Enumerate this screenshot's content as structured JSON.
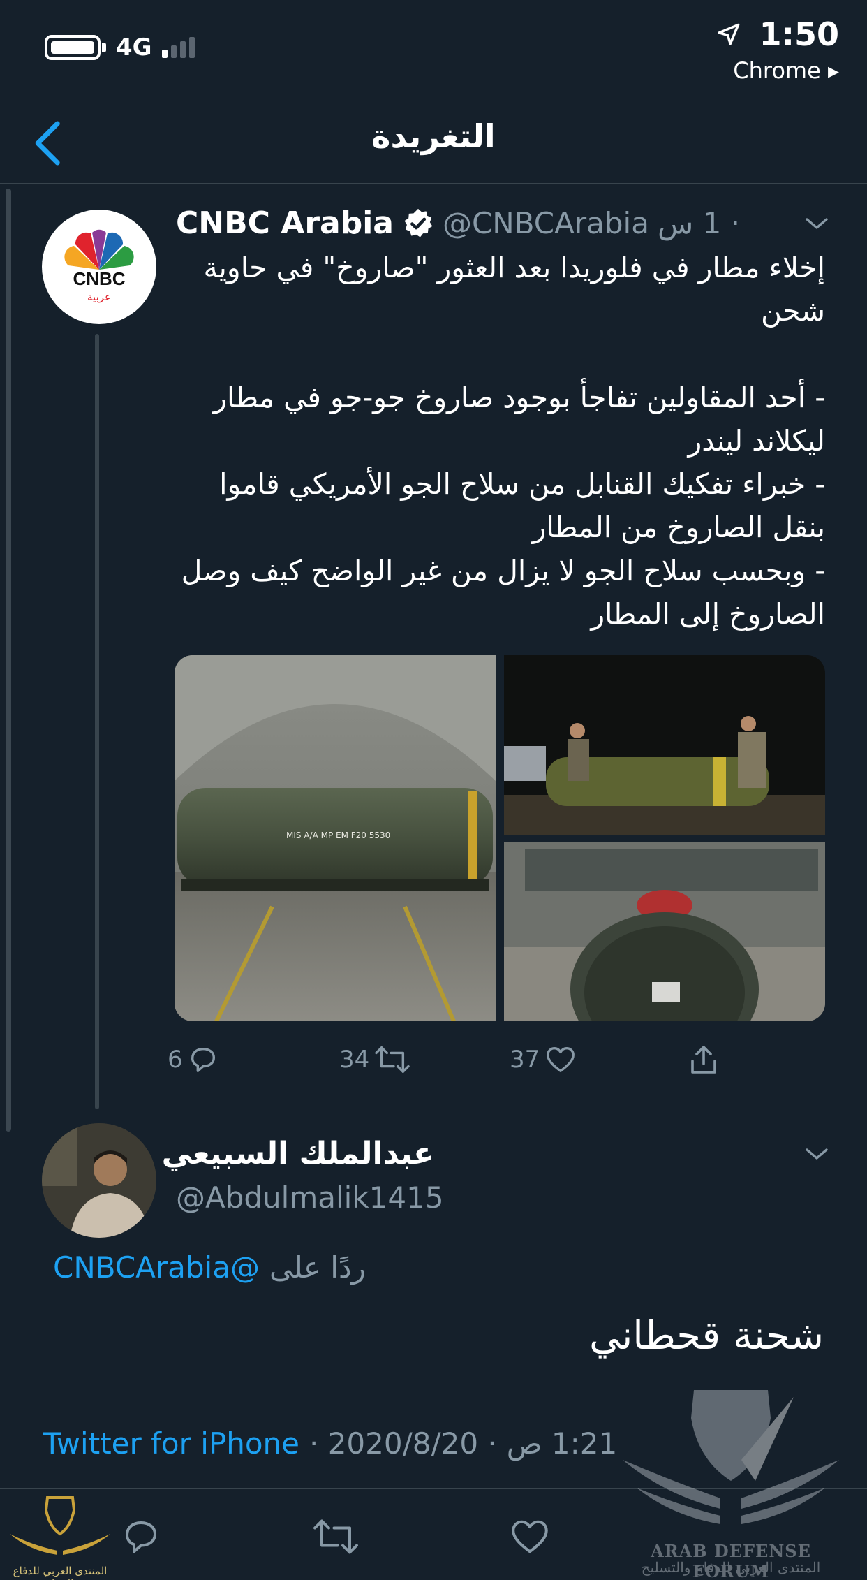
{
  "status_bar": {
    "network": "4G",
    "time": "1:50",
    "back_app": "Chrome ▸"
  },
  "header": {
    "title": "التغريدة"
  },
  "quoted_tweet": {
    "display_name": "CNBC Arabia",
    "handle": "@CNBCArabia",
    "time_ago": "· 1 س",
    "avatar_text": "CNBC",
    "avatar_subtext": "عربية",
    "text": "إخلاء مطار في فلوريدا بعد العثور \"صاروخ\" في حاوية شحن\n\n- أحد المقاولين تفاجأ بوجود صاروخ جو-جو  في مطار ليكلاند ليندر\n- خبراء تفكيك القنابل من سلاح الجو الأمريكي قاموا بنقل الصاروخ  من المطار\n- وبحسب سلاح الجو لا يزال من غير الواضح  كيف وصل الصاروخ إلى المطار",
    "media_caption": "MIS A/A MP EM F20 5530",
    "replies": "6",
    "retweets": "34",
    "likes": "37"
  },
  "reply": {
    "display_name": "عبدالملك السبيعي",
    "handle": "@Abdulmalik1415",
    "reply_prefix": "ردًا على",
    "reply_mention": "@CNBCArabia",
    "text": "شحنة قحطاني"
  },
  "meta": {
    "source": "Twitter for iPhone",
    "date": "· 2020/8/20 ·",
    "time": "1:21 ص"
  },
  "watermark": {
    "title": "ARAB DEFENSE FORUM",
    "subtitle": "المنتدى العربي للدفاع والتسليح",
    "small_subtitle": "المنتدى العربي للدفاع والتسليح"
  },
  "colors": {
    "background": "#15202b",
    "accent": "#1da1f2",
    "muted": "#8899a6",
    "divider": "#38444d"
  },
  "icons": [
    "location-arrow-icon",
    "back-chevron-icon",
    "verified-badge-icon",
    "chevron-down-icon",
    "reply-icon",
    "retweet-icon",
    "like-icon",
    "share-icon"
  ]
}
